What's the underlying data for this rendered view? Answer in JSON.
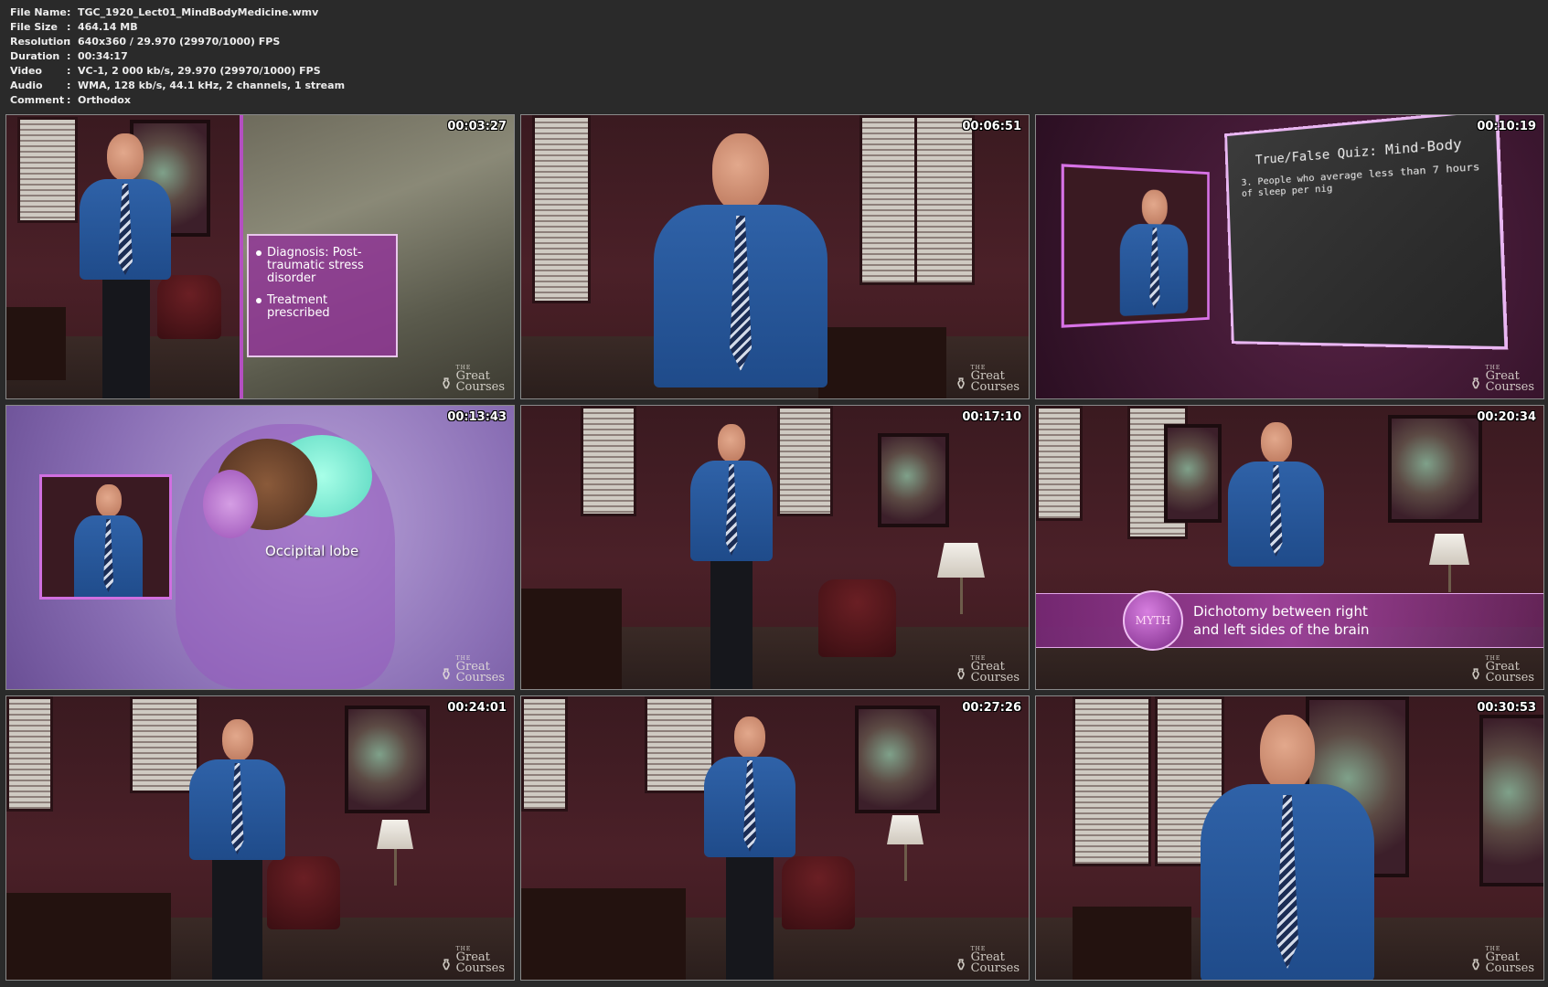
{
  "metadata": [
    {
      "key": "File Name",
      "value": "TGC_1920_Lect01_MindBodyMedicine.wmv"
    },
    {
      "key": "File Size",
      "value": "464.14 MB"
    },
    {
      "key": "Resolution",
      "value": "640x360 / 29.970 (29970/1000) FPS"
    },
    {
      "key": "Duration",
      "value": "00:34:17"
    },
    {
      "key": "Video",
      "value": "VC-1, 2 000 kb/s, 29.970 (29970/1000) FPS"
    },
    {
      "key": "Audio",
      "value": "WMA, 128 kb/s, 44.1 kHz, 2 channels, 1 stream"
    },
    {
      "key": "Comment",
      "value": "Orthodox"
    }
  ],
  "separator": ":",
  "logo": {
    "the": "THE",
    "line1": "Great",
    "line2": "Courses",
    "mark": "⚱"
  },
  "thumbnails": [
    {
      "timestamp": "00:03:27",
      "overlay": {
        "items": [
          "Diagnosis: Post-traumatic stress disorder",
          "Treatment prescribed"
        ]
      }
    },
    {
      "timestamp": "00:06:51"
    },
    {
      "timestamp": "00:10:19",
      "overlay": {
        "title": "True/False Quiz: Mind-Body",
        "question": "3. People who average less than 7 hours of sleep per nig"
      }
    },
    {
      "timestamp": "00:13:43",
      "overlay": {
        "label": "Occipital lobe"
      }
    },
    {
      "timestamp": "00:17:10"
    },
    {
      "timestamp": "00:20:34",
      "overlay": {
        "badge": "MYTH",
        "line1": "Dichotomy between right",
        "line2": "and left sides of the brain"
      }
    },
    {
      "timestamp": "00:24:01"
    },
    {
      "timestamp": "00:27:26"
    },
    {
      "timestamp": "00:30:53"
    }
  ]
}
